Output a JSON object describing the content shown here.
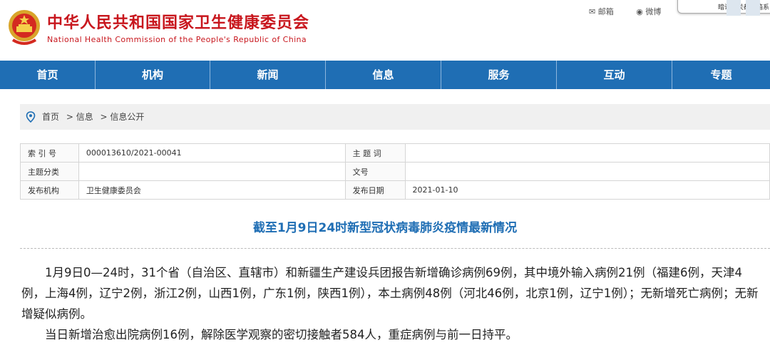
{
  "site": {
    "title_cn": "中华人民共和国国家卫生健康委员会",
    "title_en": "National Health Commission of the People's Republic of China"
  },
  "toplinks": {
    "mail": "邮箱",
    "weibo": "微博",
    "box_text": "暗访海关都邮箱系"
  },
  "nav": {
    "items": [
      {
        "label": "首页"
      },
      {
        "label": "机构"
      },
      {
        "label": "新闻"
      },
      {
        "label": "信息"
      },
      {
        "label": "服务"
      },
      {
        "label": "互动"
      },
      {
        "label": "专题"
      }
    ]
  },
  "breadcrumb": {
    "items": [
      "首页",
      "> 信息",
      "> 信息公开"
    ]
  },
  "meta": {
    "index_label": "索 引 号",
    "index_value": "000013610/2021-00041",
    "keyword_label": "主 题 词",
    "keyword_value": "",
    "category_label": "主题分类",
    "category_value": "",
    "docno_label": "文号",
    "docno_value": "",
    "org_label": "发布机构",
    "org_value": "卫生健康委员会",
    "date_label": "发布日期",
    "date_value": "2021-01-10"
  },
  "article": {
    "title": "截至1月9日24时新型冠状病毒肺炎疫情最新情况",
    "paragraphs": [
      "1月9日0—24时，31个省（自治区、直辖市）和新疆生产建设兵团报告新增确诊病例69例，其中境外输入病例21例（福建6例，天津4例，上海4例，辽宁2例，浙江2例，山西1例，广东1例，陕西1例），本土病例48例（河北46例，北京1例，辽宁1例）；无新增死亡病例；无新增疑似病例。",
      "当日新增治愈出院病例16例，解除医学观察的密切接触者584人，重症病例与前一日持平。"
    ]
  },
  "colors": {
    "brand_red": "#c8161d",
    "nav_blue": "#1f6eb4"
  }
}
